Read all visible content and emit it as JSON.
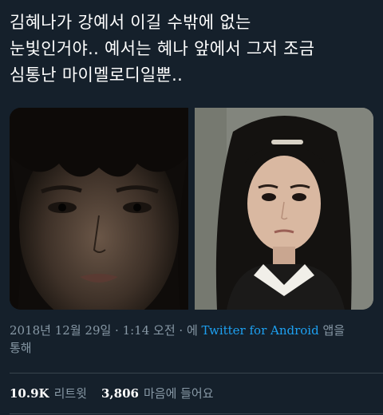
{
  "tweet": {
    "text_lines": [
      "김혜나가 강예서 이길 수밖에 없는",
      "눈빛인거야.. 예서는 혜나 앞에서 그저 조금",
      "심통난 마이멜로디일뿐.."
    ]
  },
  "meta": {
    "date": "2018년 12월 29일 · 1:14 오전 · 에 ",
    "source": "Twitter for Android",
    "suffix": " 앱을",
    "suffix2": "통해"
  },
  "stats": {
    "retweets_count": "10.9K",
    "retweets_label": "리트윗",
    "likes_count": "3,806",
    "likes_label": "마음에 들어요"
  },
  "colors": {
    "background": "#15202b",
    "muted": "#8899a6",
    "link": "#1da1f2",
    "divider": "#38444d"
  }
}
